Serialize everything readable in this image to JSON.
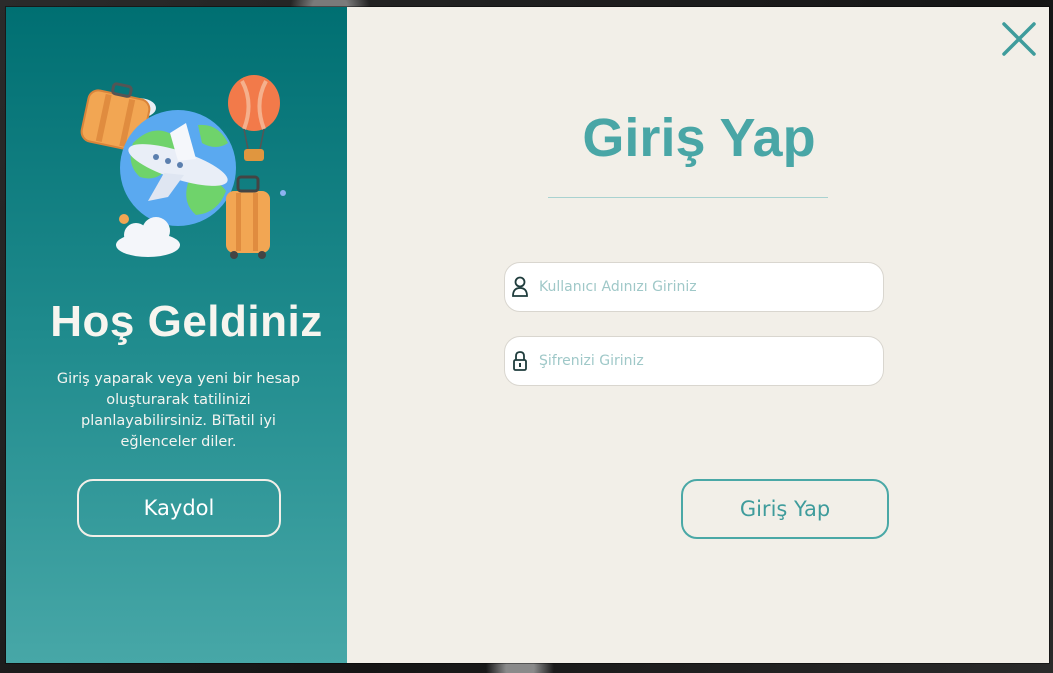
{
  "welcome": {
    "title": "Hoş Geldiniz",
    "message": "Giriş yaparak veya yeni bir hesap oluşturarak tatilinizi planlayabilirsiniz. BiTatil iyi eğlenceler diler.",
    "signup_label": "Kaydol",
    "illustration_icon": "travel-globe-illustration"
  },
  "login": {
    "title": "Giriş Yap",
    "username_placeholder": "Kullanıcı Adınızı Giriniz",
    "username_value": "",
    "password_placeholder": "Şifrenizi Giriniz",
    "password_value": "",
    "username_icon": "user-icon",
    "password_icon": "lock-icon",
    "submit_label": "Giriş Yap"
  },
  "window": {
    "close_icon": "close-icon"
  },
  "colors": {
    "teal_dark": "#006f72",
    "teal_light": "#47a7a7",
    "accent": "#49a6a6",
    "panel_bg": "#f2efe8"
  }
}
